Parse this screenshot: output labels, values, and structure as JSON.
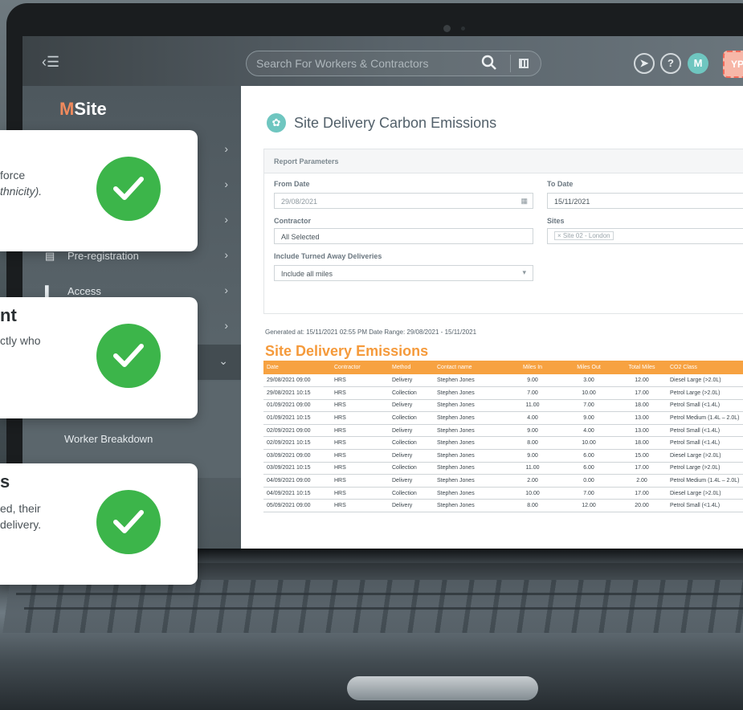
{
  "topbar": {
    "search_placeholder": "Search For Workers & Contractors",
    "icons": [
      "menu-toggle-icon",
      "search-icon",
      "qr-code-icon",
      "lightning-icon",
      "help-icon"
    ],
    "help_label": "?",
    "avatar_initial": "M",
    "user_initials": "YP"
  },
  "sidebar": {
    "logo_text": "MSite",
    "items": [
      {
        "label": "Pre-registration",
        "icon": "id-card-icon"
      },
      {
        "label": "Access",
        "icon": "door-icon"
      }
    ],
    "sub_item": "Worker Breakdown"
  },
  "page": {
    "title": "Site Delivery Carbon Emissions"
  },
  "params": {
    "heading": "Report Parameters",
    "from_date_label": "From Date",
    "from_date_value": "29/08/2021",
    "to_date_label": "To Date",
    "to_date_value": "15/11/2021",
    "contractor_label": "Contractor",
    "contractor_value": "All Selected",
    "sites_label": "Sites",
    "sites_tag": "× Site 02 - London",
    "turned_away_label": "Include Turned Away Deliveries",
    "turned_away_value": "Include all miles"
  },
  "report": {
    "generated": "Generated at: 15/11/2021 02:55 PM  Date Range: 29/08/2021 - 15/11/2021",
    "title": "Site Delivery Emissions",
    "columns": [
      "Date",
      "Contractor",
      "Method",
      "Contact name",
      "Miles In",
      "Miles Out",
      "Total Miles",
      "CO2 Class"
    ],
    "rows": [
      [
        "29/08/2021 09:00",
        "HRS",
        "Delivery",
        "Stephen Jones",
        "9.00",
        "3.00",
        "12.00",
        "Diesel Large (>2.0L)"
      ],
      [
        "29/08/2021 10:15",
        "HRS",
        "Collection",
        "Stephen Jones",
        "7.00",
        "10.00",
        "17.00",
        "Petrol Large (>2.0L)"
      ],
      [
        "01/09/2021 09:00",
        "HRS",
        "Delivery",
        "Stephen Jones",
        "11.00",
        "7.00",
        "18.00",
        "Petrol Small (<1.4L)"
      ],
      [
        "01/09/2021 10:15",
        "HRS",
        "Collection",
        "Stephen Jones",
        "4.00",
        "9.00",
        "13.00",
        "Petrol Medium (1.4L – 2.0L)"
      ],
      [
        "02/09/2021 09:00",
        "HRS",
        "Delivery",
        "Stephen Jones",
        "9.00",
        "4.00",
        "13.00",
        "Petrol Small (<1.4L)"
      ],
      [
        "02/09/2021 10:15",
        "HRS",
        "Collection",
        "Stephen Jones",
        "8.00",
        "10.00",
        "18.00",
        "Petrol Small (<1.4L)"
      ],
      [
        "03/09/2021 09:00",
        "HRS",
        "Delivery",
        "Stephen Jones",
        "9.00",
        "6.00",
        "15.00",
        "Diesel Large (>2.0L)"
      ],
      [
        "03/09/2021 10:15",
        "HRS",
        "Collection",
        "Stephen Jones",
        "11.00",
        "6.00",
        "17.00",
        "Petrol Large (>2.0L)"
      ],
      [
        "04/09/2021 09:00",
        "HRS",
        "Delivery",
        "Stephen Jones",
        "2.00",
        "0.00",
        "2.00",
        "Petrol Medium (1.4L – 2.0L)"
      ],
      [
        "04/09/2021 10:15",
        "HRS",
        "Collection",
        "Stephen Jones",
        "10.00",
        "7.00",
        "17.00",
        "Diesel Large (>2.0L)"
      ],
      [
        "05/09/2021 09:00",
        "HRS",
        "Delivery",
        "Stephen Jones",
        "8.00",
        "12.00",
        "20.00",
        "Petrol Small (<1.4L)"
      ]
    ]
  },
  "cards": [
    {
      "title": "",
      "lines": [
        "force",
        "thnicity)."
      ]
    },
    {
      "title": "nt",
      "lines": [
        "ctly who"
      ]
    },
    {
      "title": "s",
      "lines": [
        "ed, their",
        "delivery."
      ]
    }
  ],
  "colors": {
    "accent_orange": "#f7a241",
    "check_green": "#3cb54a",
    "teal": "#6fc6c0",
    "sidebar": "#535d63"
  }
}
